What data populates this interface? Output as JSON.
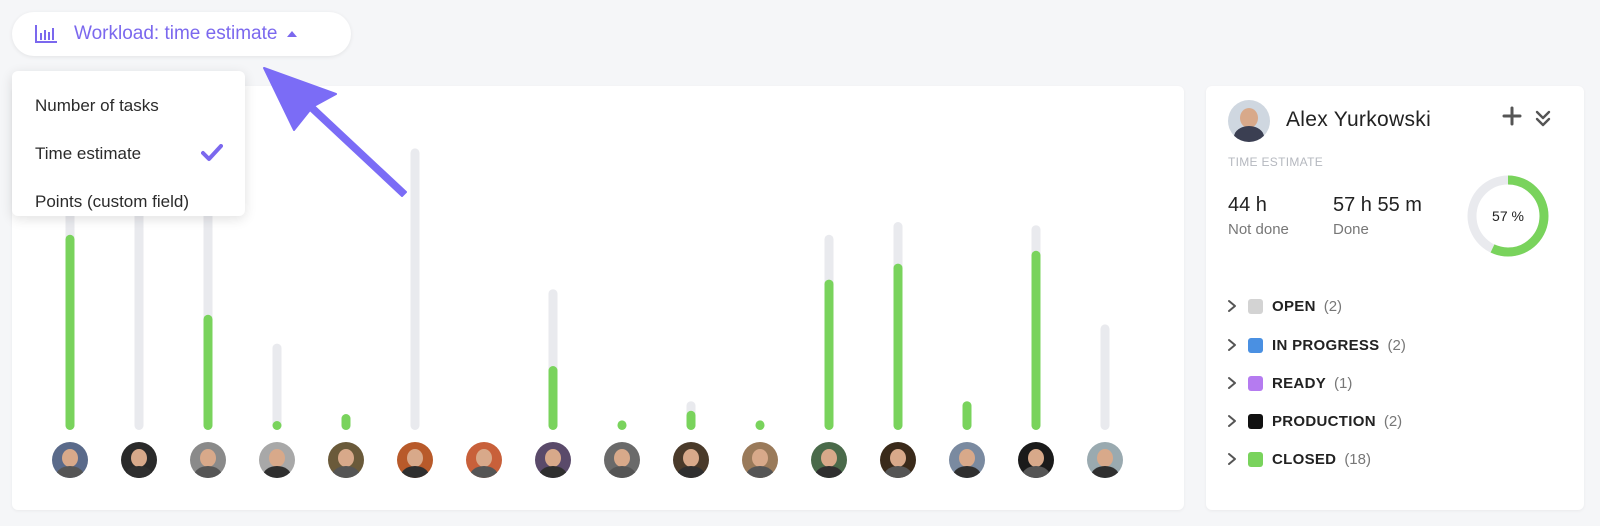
{
  "dropdown": {
    "label": "Workload: time estimate",
    "icon": "bar-chart-icon",
    "accent": "#7b68ee",
    "options": [
      {
        "label": "Number of tasks",
        "selected": false
      },
      {
        "label": "Time estimate",
        "selected": true
      },
      {
        "label": "Points (custom field)",
        "selected": false
      }
    ]
  },
  "chart_data": {
    "type": "bar",
    "colors": {
      "done": "#79d35c",
      "total": "#e9eaee"
    },
    "ylim": [
      0,
      1
    ],
    "series": [
      {
        "name": "total",
        "values": [
          0.93,
          0.96,
          0.88,
          0.27,
          0.02,
          0.88,
          0.0,
          0.44,
          0.0,
          0.09,
          0.0,
          0.61,
          0.65,
          0.08,
          0.64,
          0.33
        ]
      },
      {
        "name": "done",
        "values": [
          0.61,
          0.0,
          0.36,
          0.02,
          0.05,
          0.0,
          0.0,
          0.2,
          0.03,
          0.06,
          0.03,
          0.47,
          0.52,
          0.09,
          0.56,
          0.0
        ]
      }
    ],
    "avatars": [
      "#5a6a8a",
      "#2a2a2a",
      "#8a8a8a",
      "#a8a8a8",
      "#6a5a3a",
      "#b85a2a",
      "#c8603a",
      "#5a4a6a",
      "#6a6a6a",
      "#4a3a2a",
      "#9a7a5a",
      "#4a6a4a",
      "#3a2a1a",
      "#7a8aa0",
      "#1a1a1a",
      "#9aaab0"
    ]
  },
  "user": {
    "name": "Alex Yurkowski",
    "section_label": "TIME ESTIMATE",
    "not_done_value": "44 h",
    "not_done_caption": "Not done",
    "done_value": "57 h 55 m",
    "done_caption": "Done",
    "percent_label": "57 %",
    "percent": 0.57
  },
  "statuses": [
    {
      "name": "OPEN",
      "count": "(2)",
      "color": "#d3d3d3"
    },
    {
      "name": "IN PROGRESS",
      "count": "(2)",
      "color": "#4a90e2"
    },
    {
      "name": "READY",
      "count": "(1)",
      "color": "#b57bf0"
    },
    {
      "name": "PRODUCTION",
      "count": "(2)",
      "color": "#111111"
    },
    {
      "name": "CLOSED",
      "count": "(18)",
      "color": "#79d35c"
    }
  ]
}
